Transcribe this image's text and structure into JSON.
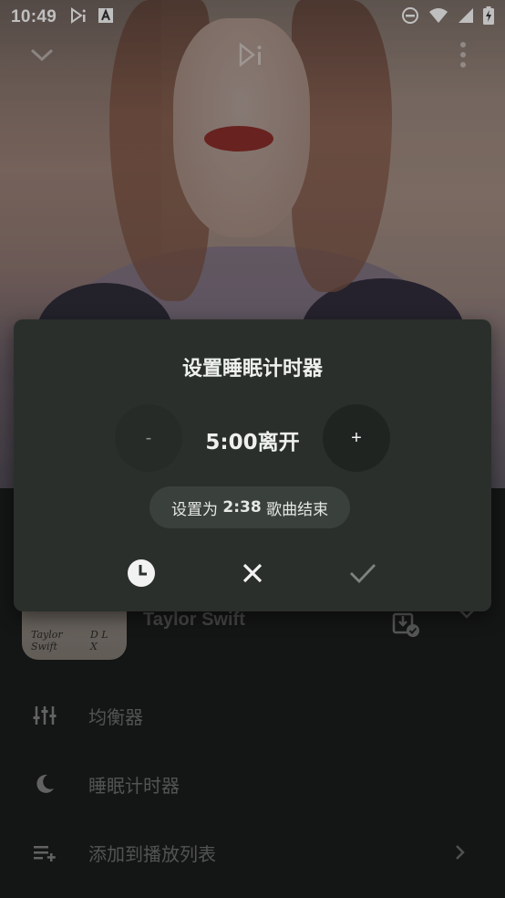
{
  "status_bar": {
    "time": "10:49",
    "icons": [
      "media-cast-icon",
      "font-a-icon",
      "do-not-disturb-icon",
      "wifi-icon",
      "signal-icon",
      "battery-charging-icon"
    ]
  },
  "player": {
    "top_icons": [
      "chevron-down-icon",
      "play-next-icon",
      "more-vertical-icon"
    ]
  },
  "dialog": {
    "title": "设置睡眠计时器",
    "minus_label": "-",
    "plus_label": "+",
    "timer_value": "5:00离开",
    "song_end_prefix": "设置为 ",
    "song_end_time": "2:38",
    "song_end_suffix": " 歌曲结束",
    "actions": [
      "clock-icon",
      "close-icon",
      "check-icon"
    ]
  },
  "track": {
    "artist": "Taylor Swift",
    "thumb_left_text": "Taylor Swift",
    "thumb_right_text": "D L X"
  },
  "menu": {
    "items": [
      {
        "label": "均衡器",
        "icon": "equalizer-icon"
      },
      {
        "label": "睡眠计时器",
        "icon": "moon-icon"
      },
      {
        "label": "添加到播放列表",
        "icon": "playlist-add-icon"
      }
    ]
  },
  "colors": {
    "dialog_bg": "#2a2f2b",
    "chip_bg": "#3a403b",
    "sheet_bg": "#1b1d1c"
  }
}
